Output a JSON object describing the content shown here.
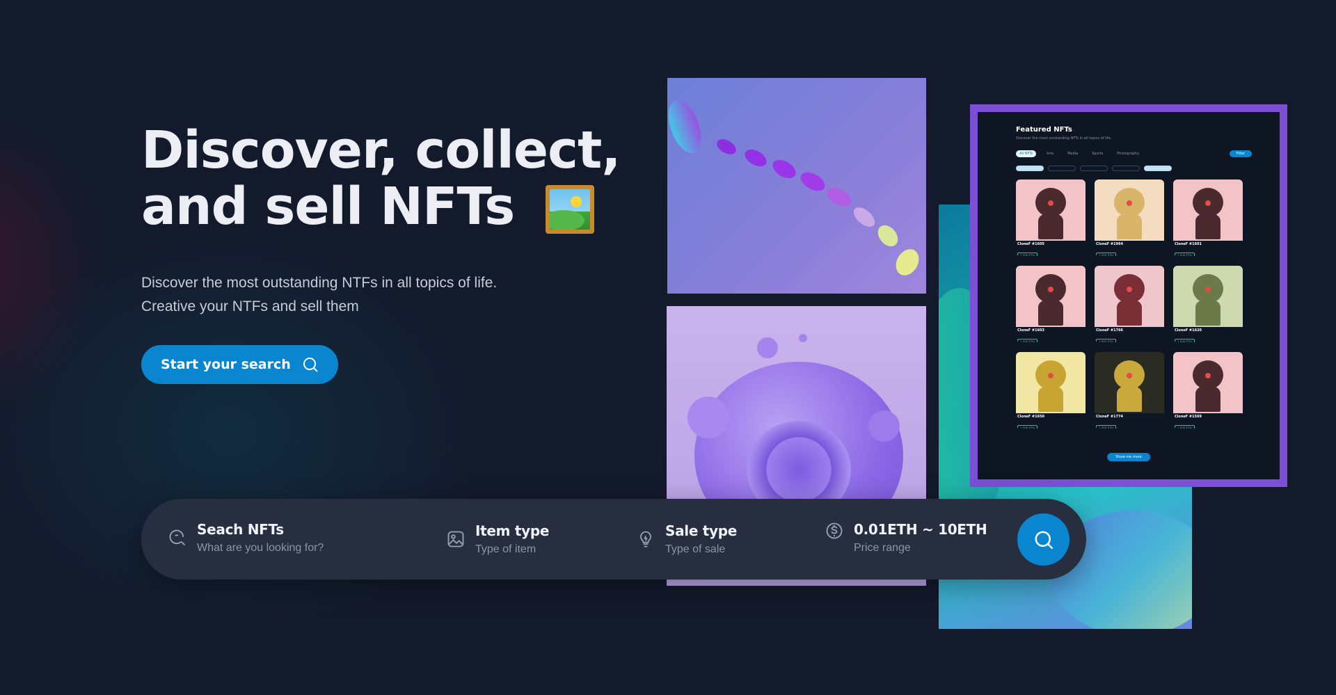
{
  "hero": {
    "title_line1": "Discover, collect,",
    "title_line2": "and sell NFTs",
    "title_emoji": "framed-picture",
    "desc_line1": "Discover the most outstanding NTFs in all topics of life.",
    "desc_line2": "Creative your NTFs and sell them",
    "cta_label": "Start your search"
  },
  "featured": {
    "title": "Featured NFTs",
    "subtitle": "Discover the most outstanding NFTs in all topics of life.",
    "tabs": [
      "All NFTs",
      "Arts",
      "Media",
      "Sports",
      "Photography"
    ],
    "filter_label": "Filter",
    "cards": [
      {
        "name": "CloneF #1605",
        "price": "1.000 ETH",
        "color": "#f2c4c8",
        "head": "#4a2a2e"
      },
      {
        "name": "CloneF #1964",
        "price": "1.000 ETH",
        "color": "#f3dcc0",
        "head": "#d9b56a"
      },
      {
        "name": "CloneF #1601",
        "price": "1.000 ETH",
        "color": "#f2c4c8",
        "head": "#4a2a2e"
      },
      {
        "name": "CloneF #1603",
        "price": "1.000 ETH",
        "color": "#f2c4c8",
        "head": "#4a2a2e"
      },
      {
        "name": "CloneF #1766",
        "price": "1.000 ETH",
        "color": "#f0c6cd",
        "head": "#7a2f36"
      },
      {
        "name": "CloneF #1620",
        "price": "1.000 ETH",
        "color": "#cfd9b0",
        "head": "#6c7a4a"
      },
      {
        "name": "CloneF #1650",
        "price": "1.000 ETH",
        "color": "#f1e6a4",
        "head": "#c8a432"
      },
      {
        "name": "CloneF #1774",
        "price": "1.000 ETH",
        "color": "#2a2b22",
        "head": "#c9a93c"
      },
      {
        "name": "CloneF #1569",
        "price": "1.000 ETH",
        "color": "#f2c4c8",
        "head": "#4a2a2e"
      }
    ],
    "more_label": "Show me more"
  },
  "search": {
    "fields": [
      {
        "label": "Seach NFTs",
        "sub": "What are you looking for?",
        "icon": "search-refresh-icon"
      },
      {
        "label": "Item type",
        "sub": "Type of item",
        "icon": "image-icon"
      },
      {
        "label": "Sale type",
        "sub": "Type of sale",
        "icon": "lightbulb-icon"
      },
      {
        "label": "0.01ETH ~ 10ETH",
        "sub": "Price range",
        "icon": "dollar-coin-icon"
      }
    ],
    "submit_icon": "search-icon"
  },
  "colors": {
    "background": "#131a2b",
    "accent": "#0a86d0",
    "frame": "#7b4fd6",
    "searchbar": "#262e3f"
  }
}
